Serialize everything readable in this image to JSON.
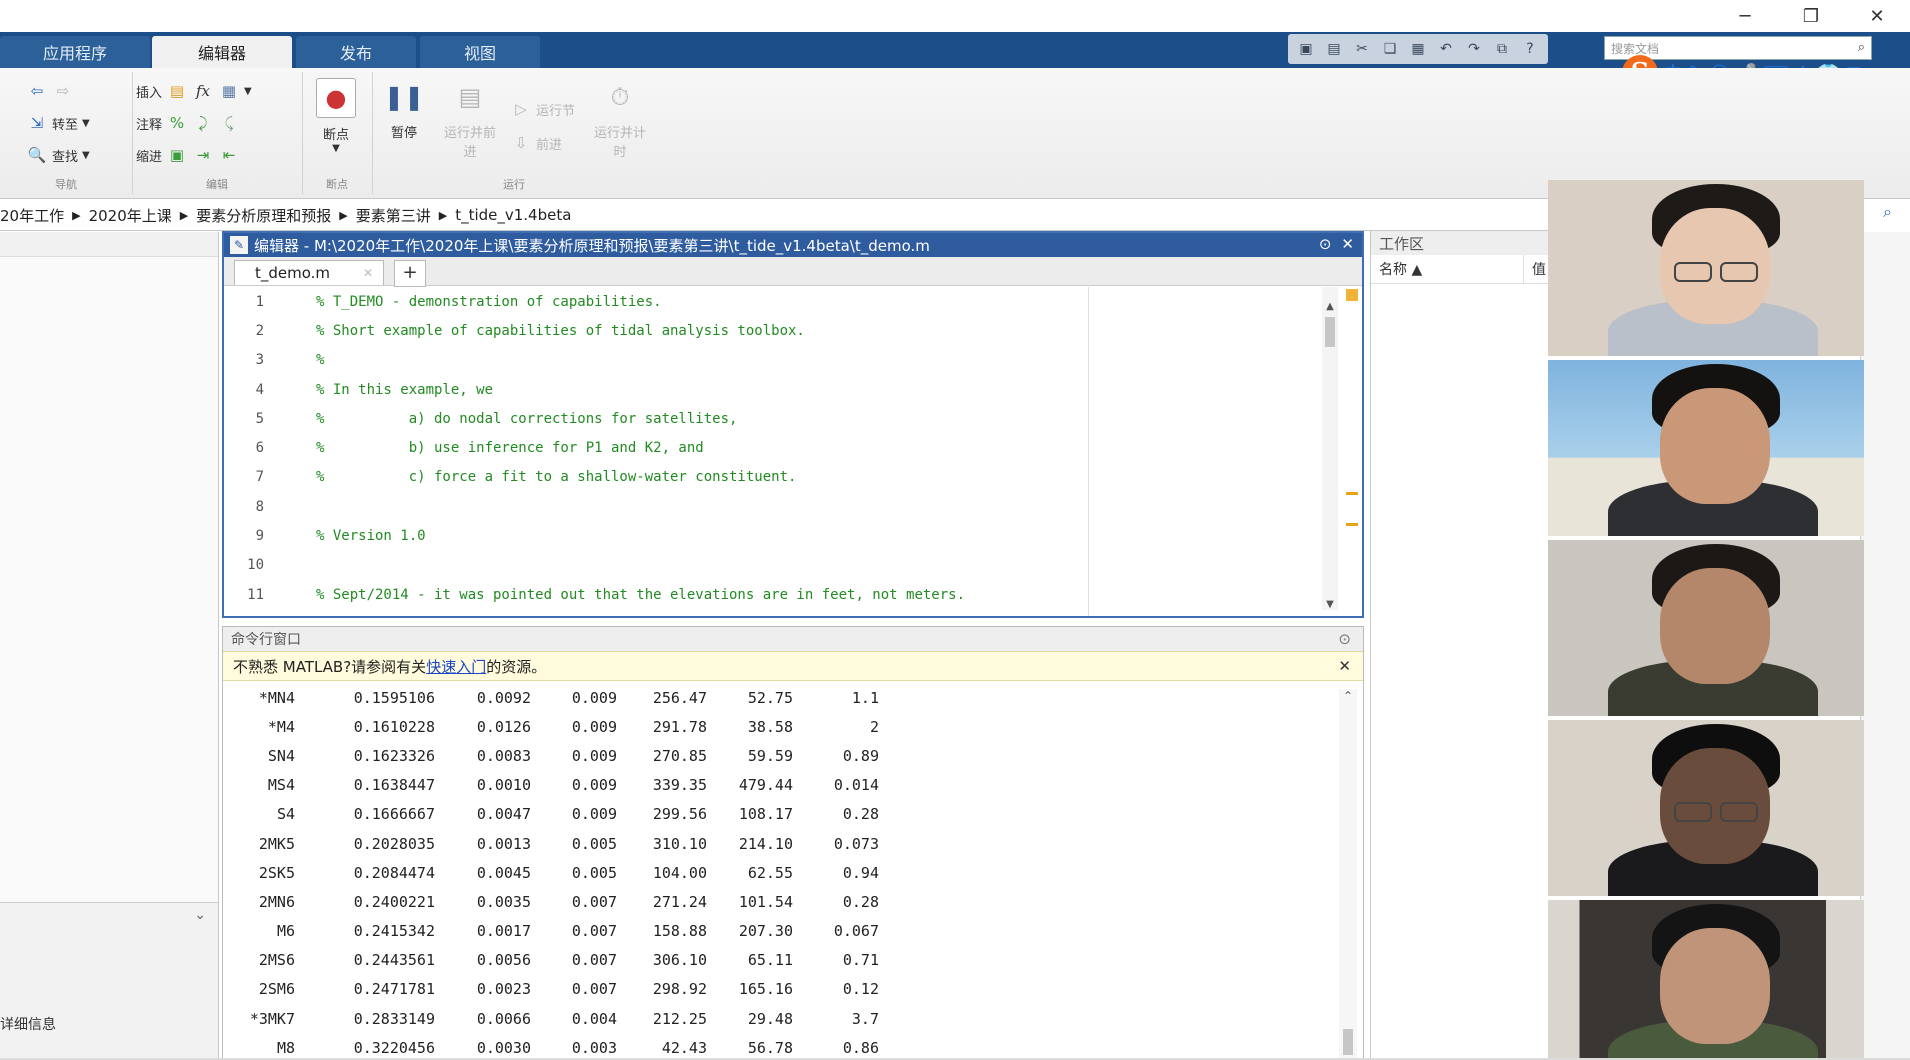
{
  "window_controls": {
    "minimize": "─",
    "restore": "❐",
    "close": "✕"
  },
  "tabs": [
    {
      "label": "应用程序",
      "active": false
    },
    {
      "label": "编辑器",
      "active": true
    },
    {
      "label": "发布",
      "active": false
    },
    {
      "label": "视图",
      "active": false
    }
  ],
  "search_doc": {
    "placeholder": "搜索文档"
  },
  "ime": {
    "logo": "S",
    "lang": "中"
  },
  "ribbon": {
    "row1": {
      "insert": "插入",
      "fx": "fx"
    },
    "row2": {
      "comment": "注释",
      "goto": "转至",
      "percent": "%"
    },
    "row3": {
      "indent": "缩进",
      "find": "查找"
    },
    "big_buttons": [
      {
        "label": "断点",
        "icon": "breakpoint-icon",
        "enabled": true
      },
      {
        "label": "暂停",
        "icon": "pause-icon",
        "enabled": true
      },
      {
        "label": "运行并前进",
        "icon": "run-advance-icon",
        "enabled": false
      },
      {
        "label": "运行并计时",
        "icon": "run-time-icon",
        "enabled": false
      }
    ],
    "small_run": [
      {
        "label": "运行节"
      },
      {
        "label": "前进"
      }
    ],
    "group_titles": [
      "导航",
      "编辑",
      "断点",
      "运行"
    ]
  },
  "address_bar": {
    "path": [
      "20年工作",
      "2020年上课",
      "要素分析原理和预报",
      "要素第三讲",
      "t_tide_v1.4beta"
    ]
  },
  "editor": {
    "title": "编辑器 - M:\\2020年工作\\2020年上课\\要素分析原理和预报\\要素第三讲\\t_tide_v1.4beta\\t_demo.m",
    "tab_name": "t_demo.m",
    "lines": [
      {
        "n": "1",
        "text": "% T_DEMO - demonstration of capabilities."
      },
      {
        "n": "2",
        "text": "% Short example of capabilities of tidal analysis toolbox."
      },
      {
        "n": "3",
        "text": "%"
      },
      {
        "n": "4",
        "text": "% In this example, we"
      },
      {
        "n": "5",
        "text": "%          a) do nodal corrections for satellites,"
      },
      {
        "n": "6",
        "text": "%          b) use inference for P1 and K2, and"
      },
      {
        "n": "7",
        "text": "%          c) force a fit to a shallow-water constituent."
      },
      {
        "n": "8",
        "text": ""
      },
      {
        "n": "9",
        "text": "% Version 1.0"
      },
      {
        "n": "10",
        "text": ""
      },
      {
        "n": "11",
        "text": "% Sept/2014 - it was pointed out that the elevations are in feet, not meters."
      }
    ]
  },
  "command_window": {
    "title": "命令行窗口",
    "notice_prefix": "不熟悉 MATLAB?请参阅有关",
    "notice_link": "快速入门",
    "notice_suffix": "的资源。",
    "rows": [
      [
        "*MN4",
        "0.1595106",
        "0.0092",
        "0.009",
        "256.47",
        "52.75",
        "1.1"
      ],
      [
        "*M4",
        "0.1610228",
        "0.0126",
        "0.009",
        "291.78",
        "38.58",
        "2"
      ],
      [
        "SN4",
        "0.1623326",
        "0.0083",
        "0.009",
        "270.85",
        "59.59",
        "0.89"
      ],
      [
        "MS4",
        "0.1638447",
        "0.0010",
        "0.009",
        "339.35",
        "479.44",
        "0.014"
      ],
      [
        "S4",
        "0.1666667",
        "0.0047",
        "0.009",
        "299.56",
        "108.17",
        "0.28"
      ],
      [
        "2MK5",
        "0.2028035",
        "0.0013",
        "0.005",
        "310.10",
        "214.10",
        "0.073"
      ],
      [
        "2SK5",
        "0.2084474",
        "0.0045",
        "0.005",
        "104.00",
        "62.55",
        "0.94"
      ],
      [
        "2MN6",
        "0.2400221",
        "0.0035",
        "0.007",
        "271.24",
        "101.54",
        "0.28"
      ],
      [
        "M6",
        "0.2415342",
        "0.0017",
        "0.007",
        "158.88",
        "207.30",
        "0.067"
      ],
      [
        "2MS6",
        "0.2443561",
        "0.0056",
        "0.007",
        "306.10",
        "65.11",
        "0.71"
      ],
      [
        "2SM6",
        "0.2471781",
        "0.0023",
        "0.007",
        "298.92",
        "165.16",
        "0.12"
      ],
      [
        "*3MK7",
        "0.2833149",
        "0.0066",
        "0.004",
        "212.25",
        "29.48",
        "3.7"
      ],
      [
        "M8",
        "0.3220456",
        "0.0030",
        "0.003",
        "42.43",
        "56.78",
        "0.86"
      ]
    ]
  },
  "workspace": {
    "title": "工作区",
    "col_name": "名称 ▲",
    "col_value": "值"
  },
  "left_panel": {
    "detail_label": "详细信息"
  },
  "participants": [
    {
      "name": "participant-1",
      "bg": "#d9cfc4",
      "face": "#e8c7b0",
      "hair": "#1e1a18",
      "body": "#b9c0c9",
      "glasses": true
    },
    {
      "name": "participant-2",
      "bg": "#7fb3de",
      "face": "#c99878",
      "hair": "#141210",
      "body": "#2d2f33",
      "glasses": false
    },
    {
      "name": "participant-3",
      "bg": "#c9c6c0",
      "face": "#b5876a",
      "hair": "#1b1816",
      "body": "#3a3c32",
      "glasses": false
    },
    {
      "name": "participant-4",
      "bg": "#d8d2c8",
      "face": "#6a4c3c",
      "hair": "#0f0e0e",
      "body": "#1a1a1c",
      "glasses": true
    },
    {
      "name": "participant-5",
      "bg": "#3e3a38",
      "face": "#c09478",
      "hair": "#141414",
      "body": "#4a5a3c",
      "glasses": false
    }
  ]
}
